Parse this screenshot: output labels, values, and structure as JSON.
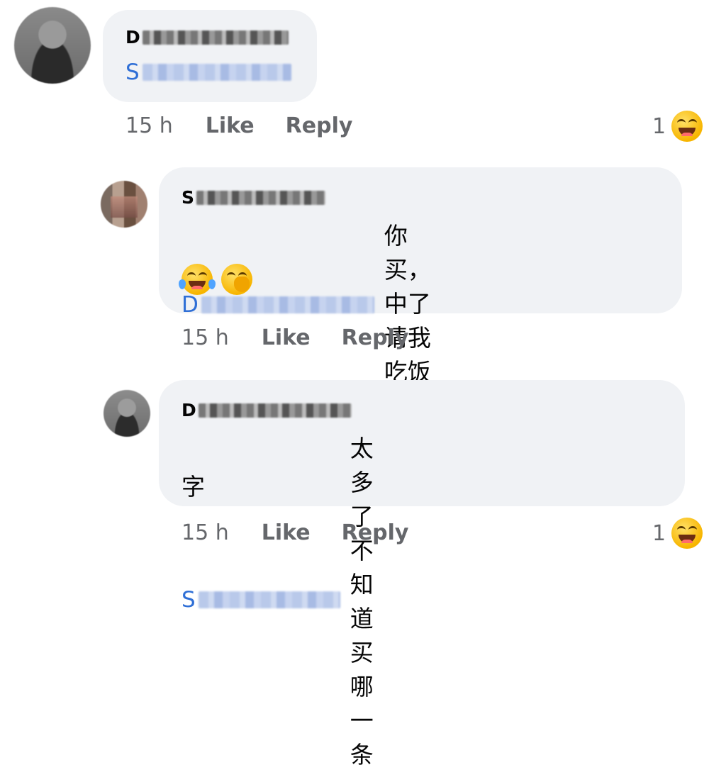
{
  "comments": [
    {
      "author": "D",
      "mention": "S",
      "text": "",
      "time": "15 h",
      "like": "Like",
      "reply": "Reply",
      "reaction_count": "1"
    },
    {
      "author": "S",
      "mention": "D",
      "text": "你买，中了请我吃饭",
      "emojis": [
        "face-with-tears-of-joy",
        "face-with-hand-over-mouth"
      ],
      "time": "15 h",
      "like": "Like",
      "reply": "Reply"
    },
    {
      "author": "D",
      "mention": "S",
      "text_line1": "太多了不知道买哪一条",
      "text_line2": "字",
      "time": "15 h",
      "like": "Like",
      "reply": "Reply",
      "reaction_count": "1"
    }
  ],
  "icons": {
    "reaction": "laughing-face-icon"
  }
}
